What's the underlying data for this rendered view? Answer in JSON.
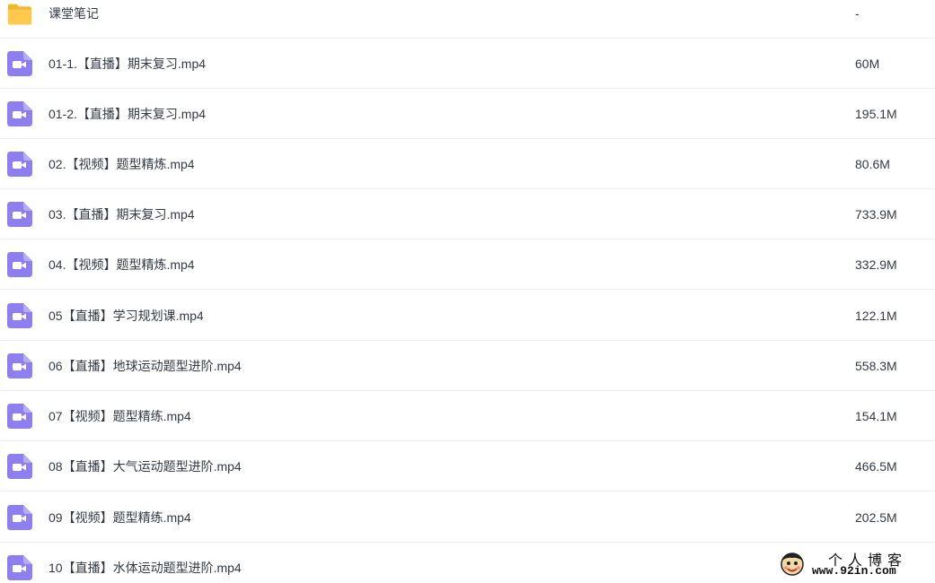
{
  "files": [
    {
      "type": "folder",
      "icon": "folder-icon",
      "name": "课堂笔记",
      "size": "-"
    },
    {
      "type": "video",
      "icon": "video-file-icon",
      "name": "01-1.【直播】期末复习.mp4",
      "size": "60M"
    },
    {
      "type": "video",
      "icon": "video-file-icon",
      "name": "01-2.【直播】期末复习.mp4",
      "size": "195.1M"
    },
    {
      "type": "video",
      "icon": "video-file-icon",
      "name": "02.【视频】题型精炼.mp4",
      "size": "80.6M"
    },
    {
      "type": "video",
      "icon": "video-file-icon",
      "name": "03.【直播】期末复习.mp4",
      "size": "733.9M"
    },
    {
      "type": "video",
      "icon": "video-file-icon",
      "name": "04.【视频】题型精炼.mp4",
      "size": "332.9M"
    },
    {
      "type": "video",
      "icon": "video-file-icon",
      "name": "05【直播】学习规划课.mp4",
      "size": "122.1M"
    },
    {
      "type": "video",
      "icon": "video-file-icon",
      "name": "06【直播】地球运动题型进阶.mp4",
      "size": "558.3M"
    },
    {
      "type": "video",
      "icon": "video-file-icon",
      "name": "07【视频】题型精练.mp4",
      "size": "154.1M"
    },
    {
      "type": "video",
      "icon": "video-file-icon",
      "name": "08【直播】大气运动题型进阶.mp4",
      "size": "466.5M"
    },
    {
      "type": "video",
      "icon": "video-file-icon",
      "name": "09【视频】题型精练.mp4",
      "size": "202.5M"
    },
    {
      "type": "video",
      "icon": "video-file-icon",
      "name": "10【直播】水体运动题型进阶.mp4",
      "size": ""
    }
  ],
  "watermark": {
    "icon": "mascot-icon",
    "title": "个人博客",
    "url": "www.92in.com"
  },
  "colors": {
    "folder": "#ffc94d",
    "video": "#8e7ff0",
    "text": "#333a45",
    "divider": "#eef0f4"
  }
}
